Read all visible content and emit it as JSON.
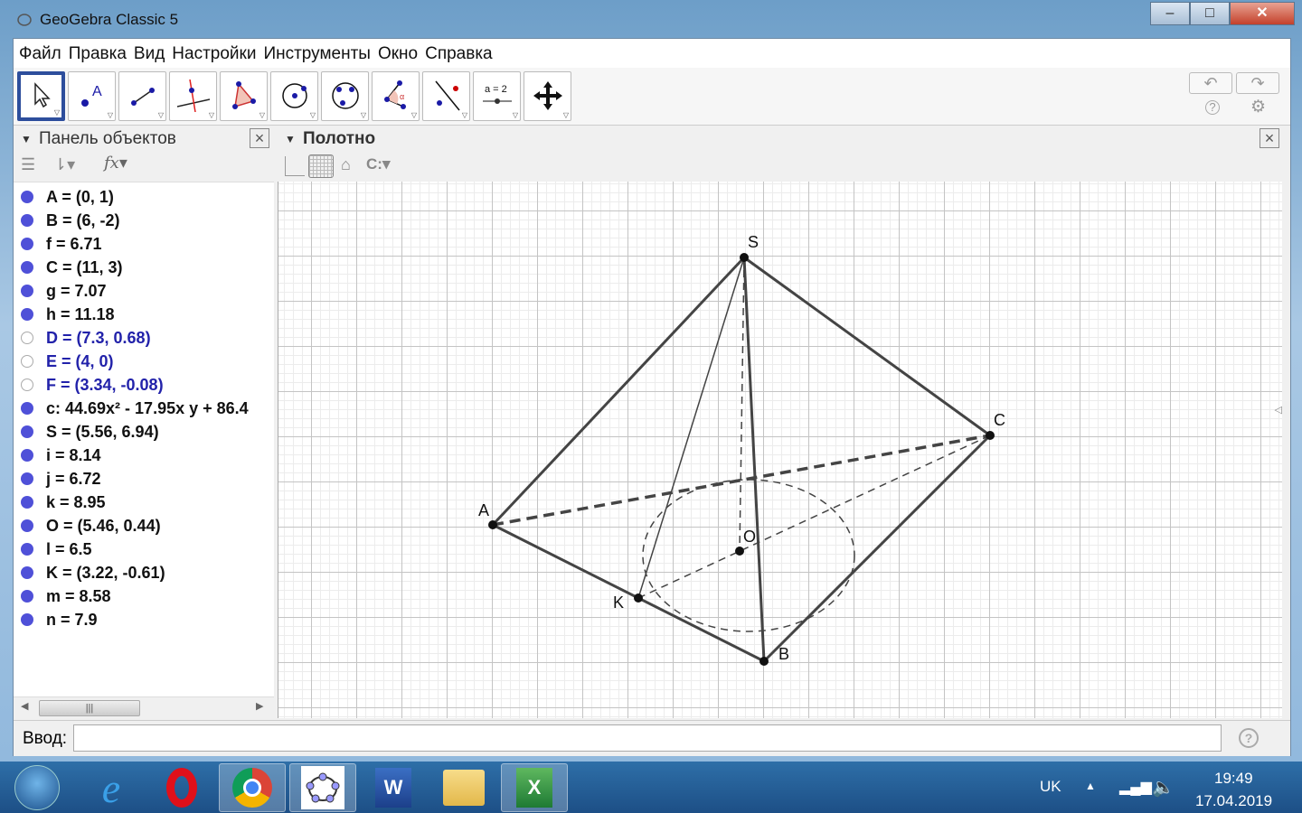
{
  "window": {
    "title": "GeoGebra Classic 5",
    "minimize": "–",
    "maximize": "□",
    "close": "✕"
  },
  "menu": [
    "Файл",
    "Правка",
    "Вид",
    "Настройки",
    "Инструменты",
    "Окно",
    "Справка"
  ],
  "tools": [
    "move",
    "point",
    "segment",
    "perpendicular-line",
    "polygon",
    "circle-center-point",
    "circle-three-points",
    "angle",
    "reflect",
    "slider",
    "move-graphics-view"
  ],
  "toolbar": {
    "undo": "↶",
    "redo": "↷",
    "help": "?",
    "settings": "⚙",
    "slider_label": "a = 2"
  },
  "algebra": {
    "title": "Панель объектов",
    "items": [
      {
        "text": "A = (0, 1)",
        "visible": true
      },
      {
        "text": "B = (6, -2)",
        "visible": true
      },
      {
        "text": "f = 6.71",
        "visible": true
      },
      {
        "text": "C = (11, 3)",
        "visible": true
      },
      {
        "text": "g = 7.07",
        "visible": true
      },
      {
        "text": "h = 11.18",
        "visible": true
      },
      {
        "text": "D = (7.3, 0.68)",
        "visible": false
      },
      {
        "text": "E = (4, 0)",
        "visible": false
      },
      {
        "text": "F = (3.34, -0.08)",
        "visible": false
      },
      {
        "text": "c: 44.69x² - 17.95x y + 86.4",
        "visible": true
      },
      {
        "text": "S = (5.56, 6.94)",
        "visible": true
      },
      {
        "text": "i = 8.14",
        "visible": true
      },
      {
        "text": "j = 6.72",
        "visible": true
      },
      {
        "text": "k = 8.95",
        "visible": true
      },
      {
        "text": "O = (5.46, 0.44)",
        "visible": true
      },
      {
        "text": "l = 6.5",
        "visible": true
      },
      {
        "text": "K = (3.22, -0.61)",
        "visible": true
      },
      {
        "text": "m = 8.58",
        "visible": true
      },
      {
        "text": "n = 7.9",
        "visible": true
      }
    ]
  },
  "graphics": {
    "title": "Полотно",
    "labels": {
      "S": "S",
      "A": "A",
      "B": "B",
      "C": "C",
      "K": "K",
      "O": "O"
    }
  },
  "input": {
    "label": "Ввод:",
    "value": "",
    "help": "?"
  },
  "taskbar": {
    "apps": [
      "start",
      "internet-explorer",
      "opera",
      "chrome",
      "geogebra",
      "word",
      "explorer",
      "excel"
    ],
    "lang": "UK",
    "time": "19:49",
    "date": "17.04.2019"
  },
  "colors": {
    "point": "#4f50d8",
    "aux_text": "#2222aa",
    "selection": "#2d4e9c"
  }
}
